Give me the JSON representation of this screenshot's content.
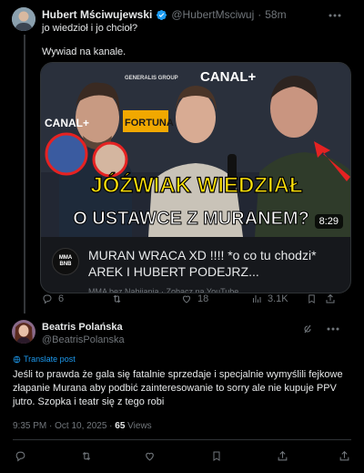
{
  "quoted": {
    "name": "Hubert Mściwujewski",
    "handle": "@HubertMsciwuj",
    "time": "58m",
    "line1": "jo wiedzioł i jo chcioł?",
    "line2": "Wywiad na kanale.",
    "video": {
      "duration": "8:29",
      "overlay_line1": "JÓŹWIAK WIEDZIAŁ",
      "overlay_line2": "O USTAWCE Z MURANEM?",
      "logo_text": "MMA BNB",
      "card_title": "MURAN WRACA XD !!!! *o co tu chodzi* AREK I HUBERT PODEJRZ...",
      "card_sub": "MMA bez Nabijania · Zobacz na YouTube",
      "brands": [
        "CANAL+",
        "FORTUNA",
        "CANAL+",
        "GENERALIS GROUP"
      ]
    },
    "actions": {
      "replies": "6",
      "reposts": "",
      "likes": "18",
      "views": "3.1K"
    }
  },
  "main": {
    "name": "Beatris Polańska",
    "handle": "@BeatrisPolanska",
    "translate": "Translate post",
    "text": "Jeśli to prawda że gala się fatalnie sprzedaje i specjalnie wymyślili fejkowe złapanie Murana aby podbić zainteresowanie to sorry ale nie kupuje PPV jutro. Szopka i teatr się z tego robi",
    "time": "9:35 PM · Oct 10, 2025 · ",
    "views_count": "65",
    "views_label": " Views"
  },
  "colors": {
    "accent": "#1d9bf0",
    "badge": "#1d9bf0",
    "muted": "#71767b",
    "divider": "#2f3336"
  }
}
